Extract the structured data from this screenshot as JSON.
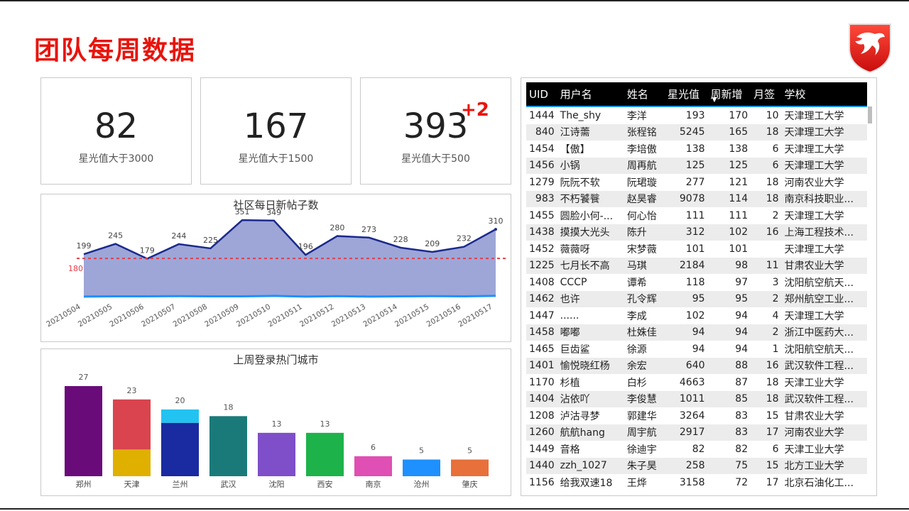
{
  "title": "团队每周数据",
  "cards": [
    {
      "value": "82",
      "label": "星光值大于3000",
      "delta": ""
    },
    {
      "value": "167",
      "label": "星光值大于1500",
      "delta": ""
    },
    {
      "value": "393",
      "label": "星光值大于500",
      "delta": "+2"
    }
  ],
  "colors": {
    "title_red": "#e8140c",
    "line_navy": "#1b2a8c",
    "area_fill": "#9ea6d8",
    "ref_line": "#e0404a",
    "lower_line": "#1e90ff"
  },
  "line_chart": {
    "title": "社区每日新帖子数",
    "chart_data": {
      "type": "area",
      "x": [
        "20210504",
        "20210505",
        "20210506",
        "20210507",
        "20210508",
        "20210509",
        "20210510",
        "20210511",
        "20210512",
        "20210513",
        "20210514",
        "20210515",
        "20210516",
        "20210517"
      ],
      "series": [
        {
          "values": [
            199,
            245,
            179,
            244,
            225,
            351,
            349,
            196,
            280,
            273,
            228,
            209,
            232,
            310
          ]
        },
        {
          "values": [
            10,
            11,
            11,
            12,
            11,
            11,
            13,
            10,
            12,
            10,
            11,
            12,
            11,
            13
          ]
        }
      ],
      "reference_line": {
        "value": 180,
        "label": "180"
      },
      "ylim": [
        0,
        380
      ]
    }
  },
  "bar_chart": {
    "title": "上周登录热门城市",
    "chart_data": {
      "type": "bar",
      "categories": [
        "郑州",
        "天津",
        "兰州",
        "武汉",
        "沈阳",
        "西安",
        "南京",
        "沧州",
        "肇庆"
      ],
      "values": [
        27,
        23,
        20,
        18,
        13,
        13,
        6,
        5,
        5
      ],
      "segments": [
        [
          {
            "value": 27,
            "color": "#6a0b7a"
          }
        ],
        [
          {
            "value": 8,
            "color": "#e0b000"
          },
          {
            "value": 15,
            "color": "#d9444e"
          }
        ],
        [
          {
            "value": 16,
            "color": "#1a2aa0"
          },
          {
            "value": 4,
            "color": "#22c3f0"
          }
        ],
        [
          {
            "value": 18,
            "color": "#1a7a7a"
          }
        ],
        [
          {
            "value": 13,
            "color": "#7e4fc8"
          }
        ],
        [
          {
            "value": 13,
            "color": "#1db34a"
          }
        ],
        [
          {
            "value": 6,
            "color": "#e04fb3"
          }
        ],
        [
          {
            "value": 5,
            "color": "#1e90ff"
          }
        ],
        [
          {
            "value": 5,
            "color": "#e8703a"
          }
        ]
      ],
      "ylim": [
        0,
        27
      ]
    }
  },
  "table": {
    "headers": [
      "UID",
      "用户名",
      "姓名",
      "星光值",
      "周新增",
      "月签",
      "学校"
    ],
    "sort_indicator": "▼",
    "rows": [
      [
        "1444",
        "The_shy",
        "李洋",
        "193",
        "170",
        "10",
        "天津理工大学"
      ],
      [
        "840",
        "江诗薷",
        "张程铭",
        "5245",
        "165",
        "18",
        "天津理工大学"
      ],
      [
        "1454",
        "【傲】",
        "李培傲",
        "138",
        "138",
        "6",
        "天津理工大学"
      ],
      [
        "1456",
        "小锅",
        "周再航",
        "125",
        "125",
        "6",
        "天津理工大学"
      ],
      [
        "1279",
        "阮阮不软",
        "阮珺璇",
        "277",
        "121",
        "18",
        "河南农业大学"
      ],
      [
        "983",
        "不朽饕餮",
        "赵昊睿",
        "9078",
        "114",
        "18",
        "南京科技职业..."
      ],
      [
        "1455",
        "圆脸小何-...",
        "何心怡",
        "111",
        "111",
        "2",
        "天津理工大学"
      ],
      [
        "1438",
        "摸摸大光头",
        "陈升",
        "312",
        "102",
        "16",
        "上海工程技术..."
      ],
      [
        "1452",
        "薇薇呀",
        "宋梦薇",
        "101",
        "101",
        "",
        "天津理工大学"
      ],
      [
        "1225",
        "七月长不高",
        "马琪",
        "2184",
        "98",
        "11",
        "甘肃农业大学"
      ],
      [
        "1408",
        "CCCP",
        "谭希",
        "118",
        "97",
        "3",
        "沈阳航空航天..."
      ],
      [
        "1462",
        "也许",
        "孔令辉",
        "95",
        "95",
        "2",
        "郑州航空工业..."
      ],
      [
        "1447",
        "......",
        "李成",
        "102",
        "94",
        "4",
        "天津理工大学"
      ],
      [
        "1458",
        "嘟嘟",
        "杜姝佳",
        "94",
        "94",
        "2",
        "浙江中医药大..."
      ],
      [
        "1465",
        "巨齿鲨",
        "徐源",
        "94",
        "94",
        "1",
        "沈阳航空航天..."
      ],
      [
        "1401",
        "愉悦晓红杨",
        "余宏",
        "640",
        "88",
        "16",
        "武汉软件工程..."
      ],
      [
        "1170",
        "杉植",
        "白杉",
        "4663",
        "87",
        "18",
        "天津工业大学"
      ],
      [
        "1404",
        "沾依吖",
        "李俊慧",
        "1011",
        "85",
        "18",
        "武汉软件工程..."
      ],
      [
        "1208",
        "泸沽寻梦",
        "郭建华",
        "3264",
        "83",
        "15",
        "甘肃农业大学"
      ],
      [
        "1260",
        "航航hang",
        "周宇航",
        "2917",
        "83",
        "17",
        "河南农业大学"
      ],
      [
        "1449",
        "音格",
        "徐迪宇",
        "82",
        "82",
        "6",
        "天津工业大学"
      ],
      [
        "1440",
        "zzh_1027",
        "朱子昊",
        "258",
        "75",
        "15",
        "北方工业大学"
      ],
      [
        "1156",
        "给我双速18",
        "王烨",
        "3158",
        "72",
        "17",
        "北京石油化工..."
      ]
    ]
  }
}
